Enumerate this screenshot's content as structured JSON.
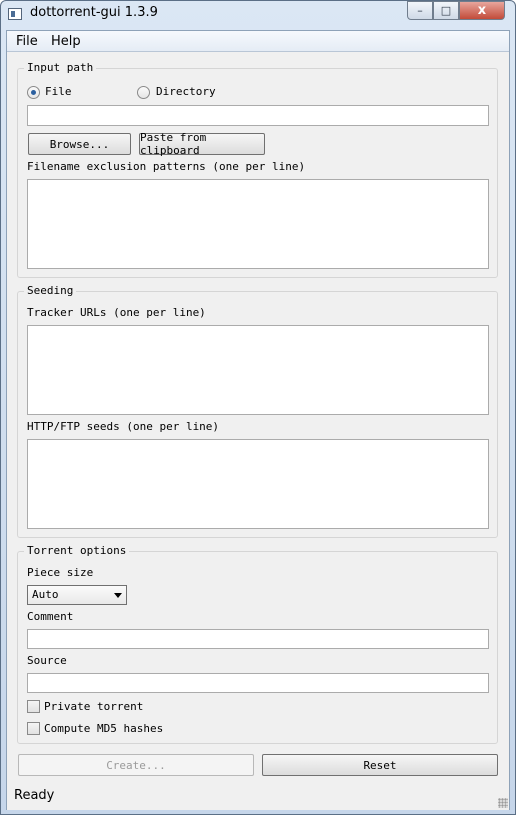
{
  "window": {
    "title": "dottorrent-gui 1.3.9",
    "controls": {
      "minimize": "–",
      "maximize": "□",
      "close": "x"
    }
  },
  "menu": {
    "items": [
      "File",
      "Help"
    ]
  },
  "input_path": {
    "title": "Input path",
    "file_label": "File",
    "directory_label": "Directory",
    "selected": "File",
    "path_value": "",
    "browse_label": "Browse...",
    "paste_label": "Paste from clipboard",
    "exclusion_label": "Filename exclusion patterns (one per line)",
    "exclusion_value": ""
  },
  "seeding": {
    "title": "Seeding",
    "tracker_label": "Tracker URLs (one per line)",
    "tracker_value": "",
    "http_label": "HTTP/FTP seeds (one per line)",
    "http_value": ""
  },
  "torrent_options": {
    "title": "Torrent options",
    "piece_size_label": "Piece size",
    "piece_size_value": "Auto",
    "comment_label": "Comment",
    "comment_value": "",
    "source_label": "Source",
    "source_value": "",
    "private_label": "Private torrent",
    "private_checked": false,
    "md5_label": "Compute MD5 hashes",
    "md5_checked": false
  },
  "actions": {
    "create_label": "Create...",
    "create_enabled": false,
    "reset_label": "Reset"
  },
  "status": {
    "text": "Ready"
  }
}
